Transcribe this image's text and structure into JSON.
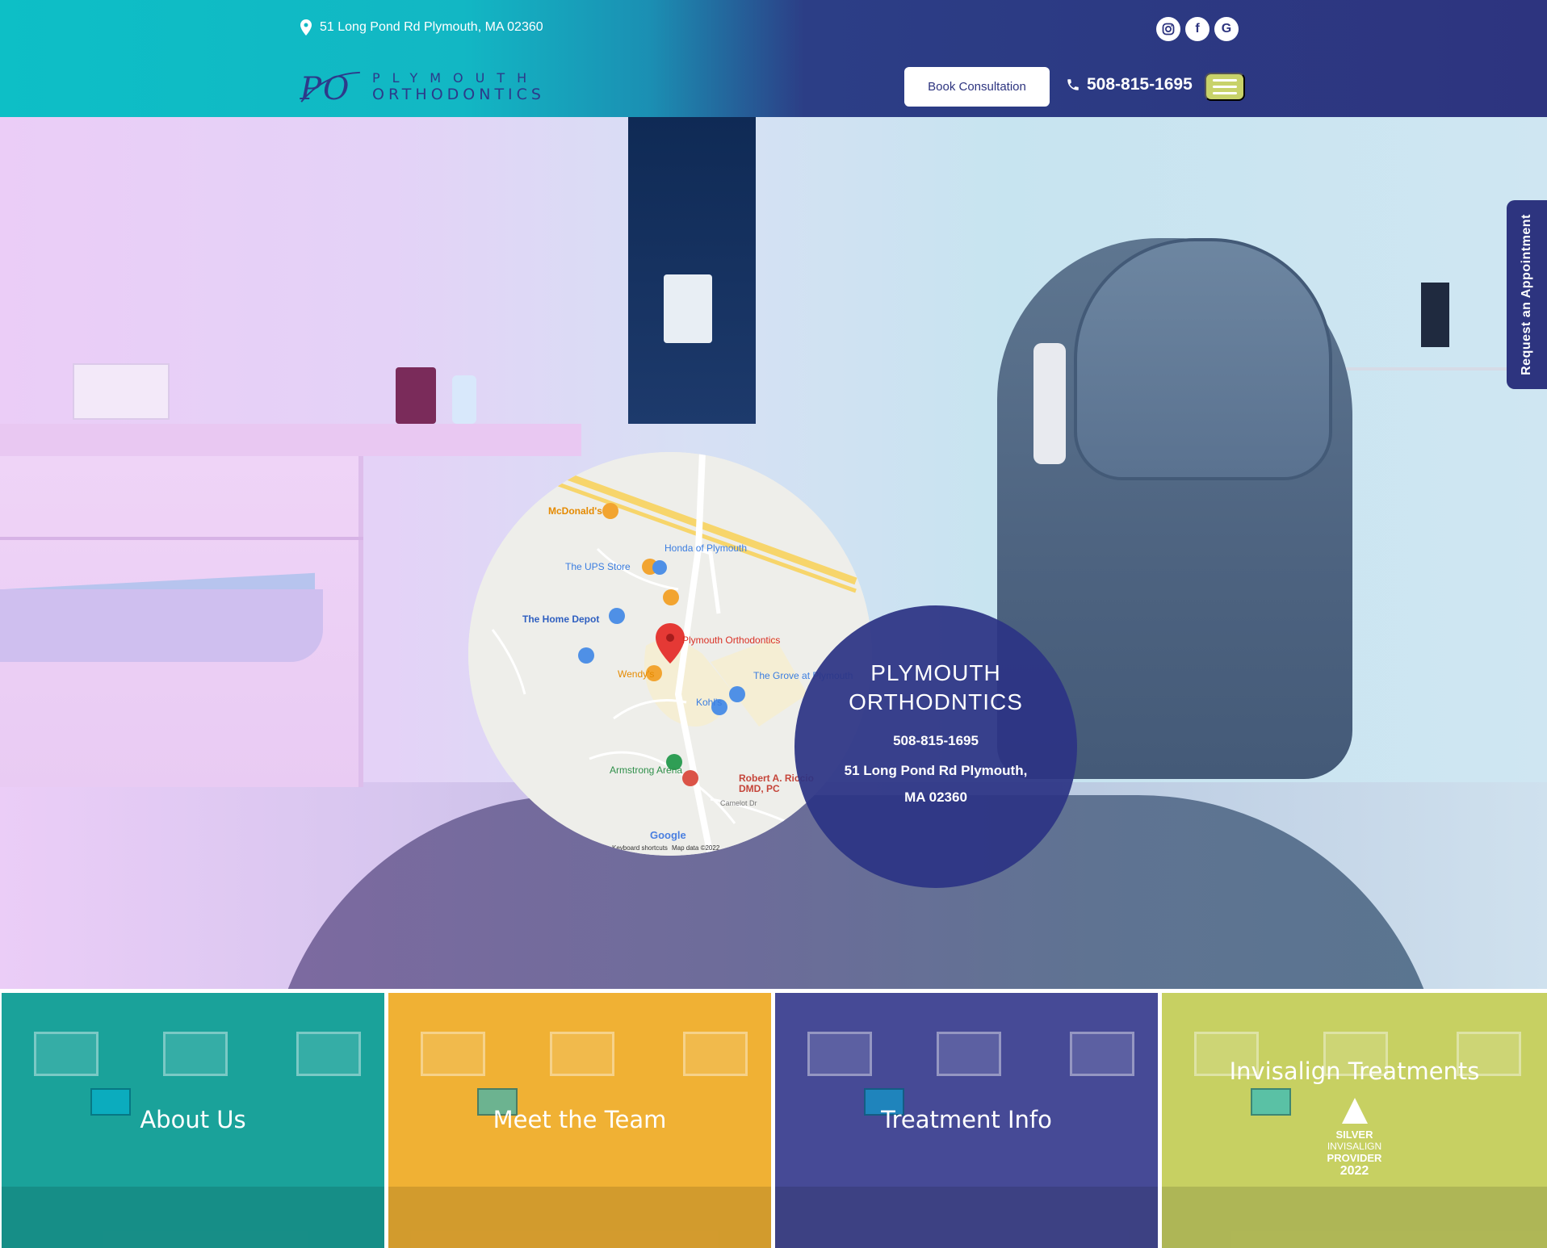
{
  "header": {
    "address": "51 Long Pond Rd Plymouth, MA 02360",
    "logo": {
      "monogram": "PO",
      "line1": "PLYMOUTH",
      "line2": "ORTHODONTICS"
    },
    "social": [
      {
        "icon": "instagram-icon",
        "glyph": "◎"
      },
      {
        "icon": "facebook-icon",
        "glyph": "f"
      },
      {
        "icon": "google-icon",
        "glyph": "G"
      }
    ],
    "book_button": "Book Consultation",
    "phone": "508-815-1695",
    "colors": {
      "teal": "#0dbfc6",
      "navy": "#2d347f",
      "menu": "#c8d26a"
    }
  },
  "map": {
    "labels": {
      "mcdonalds": "McDonald's",
      "honda": "Honda of Plymouth",
      "ups": "The UPS Store",
      "home_depot": "The Home Depot",
      "plymouth_ortho": "Plymouth Orthodontics",
      "wendys": "Wendy's",
      "grove": "The Grove at Plymouth",
      "kohls": "Kohl's",
      "armstrong": "Armstrong Arena",
      "robert1": "Robert A. Riccio",
      "robert2": "DMD, PC",
      "camelot": "Camelot Dr",
      "google": "Google",
      "shortcuts": "Keyboard shortcuts",
      "mapdata": "Map data ©2022"
    }
  },
  "info": {
    "title_line1": "PLYMOUTH",
    "title_line2": "ORTHODNTICS",
    "phone": "508-815-1695",
    "address": "51 Long Pond Rd Plymouth, MA 02360"
  },
  "side_tab": "Request an Appointment",
  "tiles": [
    {
      "label": "About Us",
      "color": "#1aa29a"
    },
    {
      "label": "Meet the Team",
      "color": "#f0b134"
    },
    {
      "label": "Treatment Info",
      "color": "#464a96"
    },
    {
      "label": "Invisalign Treatments",
      "color": "#c7d062",
      "badge": {
        "l1": "SILVER",
        "l2": "INVISALIGN",
        "l3": "PROVIDER",
        "l4": "2022"
      }
    }
  ]
}
